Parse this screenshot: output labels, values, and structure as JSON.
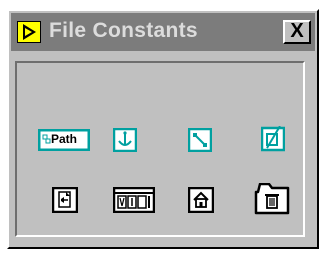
{
  "window": {
    "title": "File Constants",
    "close_label": "X"
  },
  "palette": {
    "path_constant_label": "Path"
  },
  "colors": {
    "accent": "#00a0a0",
    "titlebar": "#7c7c7c",
    "face": "#c0c0c0"
  },
  "icons": [
    "path-constant-icon",
    "refnum-icon",
    "empty-path-icon",
    "not-a-path-icon",
    "default-directory-icon",
    "vi-library-icon",
    "home-directory-icon",
    "temporary-directory-icon"
  ]
}
